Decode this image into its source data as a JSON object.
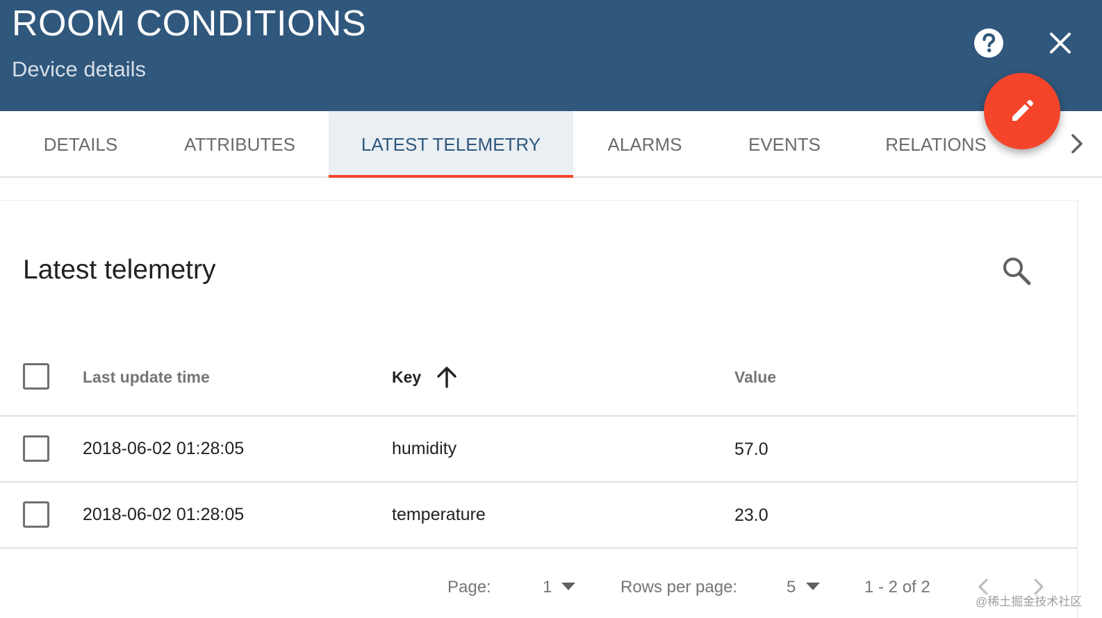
{
  "header": {
    "title": "ROOM CONDITIONS",
    "subtitle": "Device details",
    "help_icon": "help-circle-icon",
    "close_icon": "close-icon"
  },
  "fab": {
    "icon": "pencil-icon",
    "color": "#f4452b"
  },
  "tabs": [
    {
      "label": "DETAILS",
      "active": false
    },
    {
      "label": "ATTRIBUTES",
      "active": false
    },
    {
      "label": "LATEST TELEMETRY",
      "active": true
    },
    {
      "label": "ALARMS",
      "active": false
    },
    {
      "label": "EVENTS",
      "active": false
    },
    {
      "label": "RELATIONS",
      "active": false
    }
  ],
  "card": {
    "title": "Latest telemetry",
    "search_icon": "search-icon"
  },
  "table": {
    "columns": {
      "time": "Last update time",
      "key": "Key",
      "value": "Value"
    },
    "sort": {
      "column": "Key",
      "direction": "ascending"
    },
    "rows": [
      {
        "time": "2018-06-02 01:28:05",
        "key": "humidity",
        "value": "57.0"
      },
      {
        "time": "2018-06-02 01:28:05",
        "key": "temperature",
        "value": "23.0"
      }
    ]
  },
  "paginator": {
    "page_label": "Page:",
    "page_value": "1",
    "rows_label": "Rows per page:",
    "rows_value": "5",
    "range": "1 - 2 of 2"
  },
  "watermark": "@稀土掘金技术社区",
  "colors": {
    "header_bg": "#30577c",
    "accent": "#f4452b",
    "active_tab_text": "#30577c"
  }
}
